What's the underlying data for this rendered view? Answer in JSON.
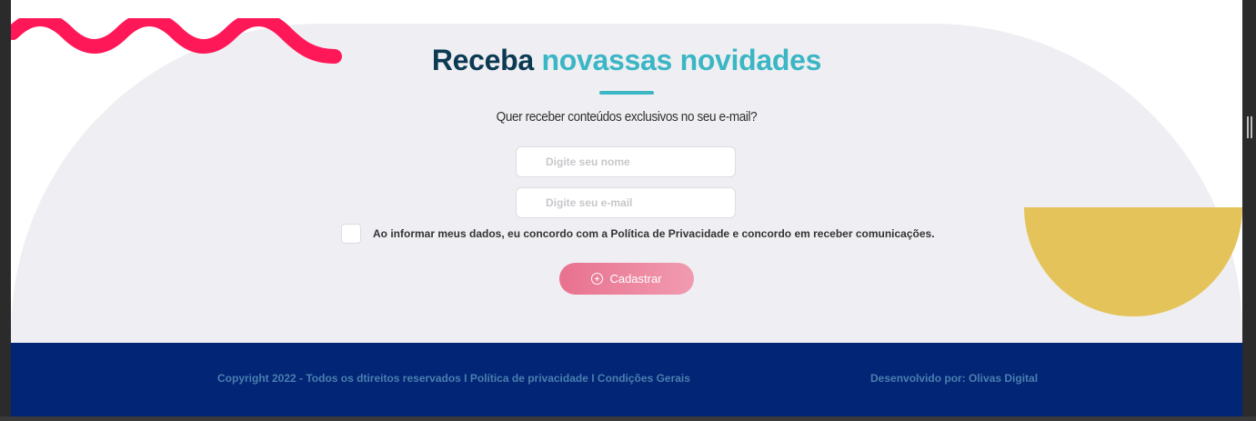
{
  "newsletter": {
    "title_part1": "Receba",
    "title_part2": "novassas novidades",
    "subtitle": "Quer receber conteúdos exclusivos no seu e-mail?",
    "name_placeholder": "Digite seu nome",
    "email_placeholder": "Digite seu e-mail",
    "consent_text": "Ao informar meus dados, eu concordo com a Política de Privacidade e concordo em receber comunicações.",
    "submit_label": "Cadastrar"
  },
  "footer": {
    "copyright": "Copyright 2022 - Todos os dtireitos reservados I Política de privacidade I Condições Gerais",
    "developer": "Desenvolvido por: Olivas Digital"
  },
  "colors": {
    "title_dark": "#0b3a52",
    "accent_teal": "#3bb6c4",
    "wave_pink": "#ff1858",
    "circle_yellow": "#e4c45a",
    "button_pink": "#e8718f",
    "footer_navy": "#022575"
  },
  "icons": {
    "submit_icon": "plus-circle-icon"
  }
}
